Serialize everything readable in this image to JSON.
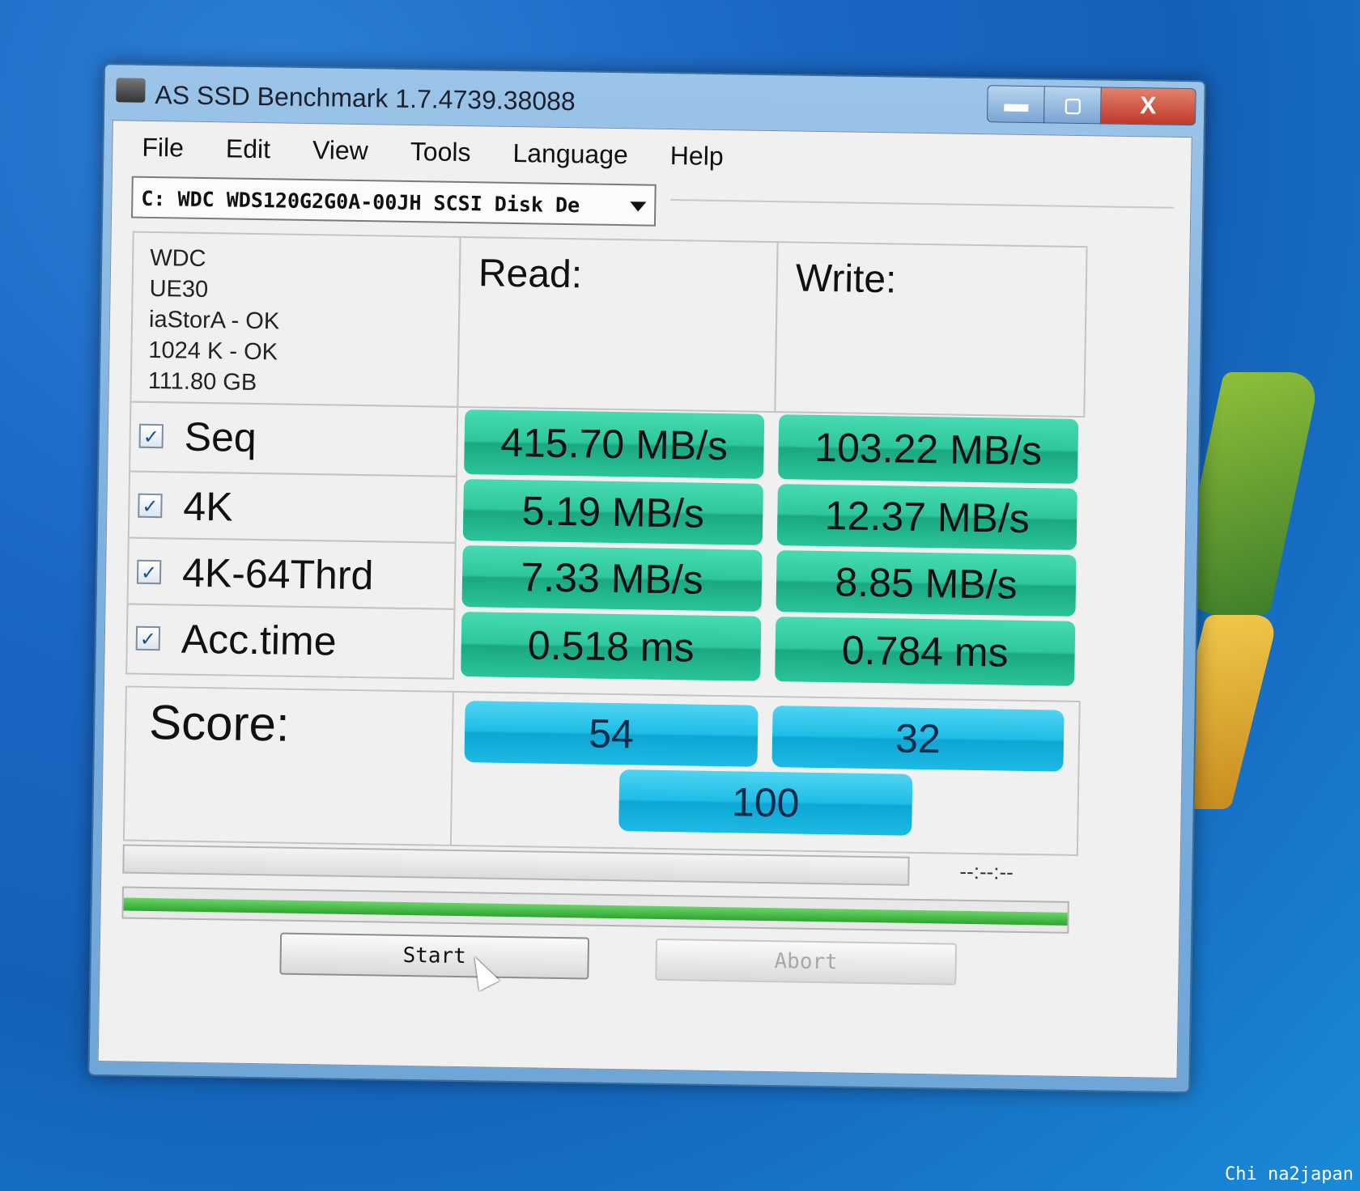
{
  "window": {
    "title": "AS SSD Benchmark 1.7.4739.38088",
    "close_label": "X"
  },
  "menu": [
    "File",
    "Edit",
    "View",
    "Tools",
    "Language",
    "Help"
  ],
  "drive_select": {
    "value": "C: WDC WDS120G2G0A-00JH SCSI Disk De"
  },
  "drive_info": [
    "WDC",
    "UE30",
    "iaStorA - OK",
    "1024 K - OK",
    "111.80 GB"
  ],
  "columns": {
    "read": "Read:",
    "write": "Write:"
  },
  "tests": [
    {
      "label": "Seq",
      "checked": true,
      "read": "415.70 MB/s",
      "write": "103.22 MB/s"
    },
    {
      "label": "4K",
      "checked": true,
      "read": "5.19 MB/s",
      "write": "12.37 MB/s"
    },
    {
      "label": "4K-64Thrd",
      "checked": true,
      "read": "7.33 MB/s",
      "write": "8.85 MB/s"
    },
    {
      "label": "Acc.time",
      "checked": true,
      "read": "0.518 ms",
      "write": "0.784 ms"
    }
  ],
  "score": {
    "label": "Score:",
    "read": "54",
    "write": "32",
    "total": "100"
  },
  "progress": {
    "time": "--:--:--",
    "overall_fraction": 1.0
  },
  "buttons": {
    "start": "Start",
    "abort": "Abort"
  },
  "watermark": "Chi na2japan",
  "colors": {
    "result_green": "#2ec79d",
    "score_blue": "#1fbde6",
    "progress_green": "#2ea52e"
  }
}
